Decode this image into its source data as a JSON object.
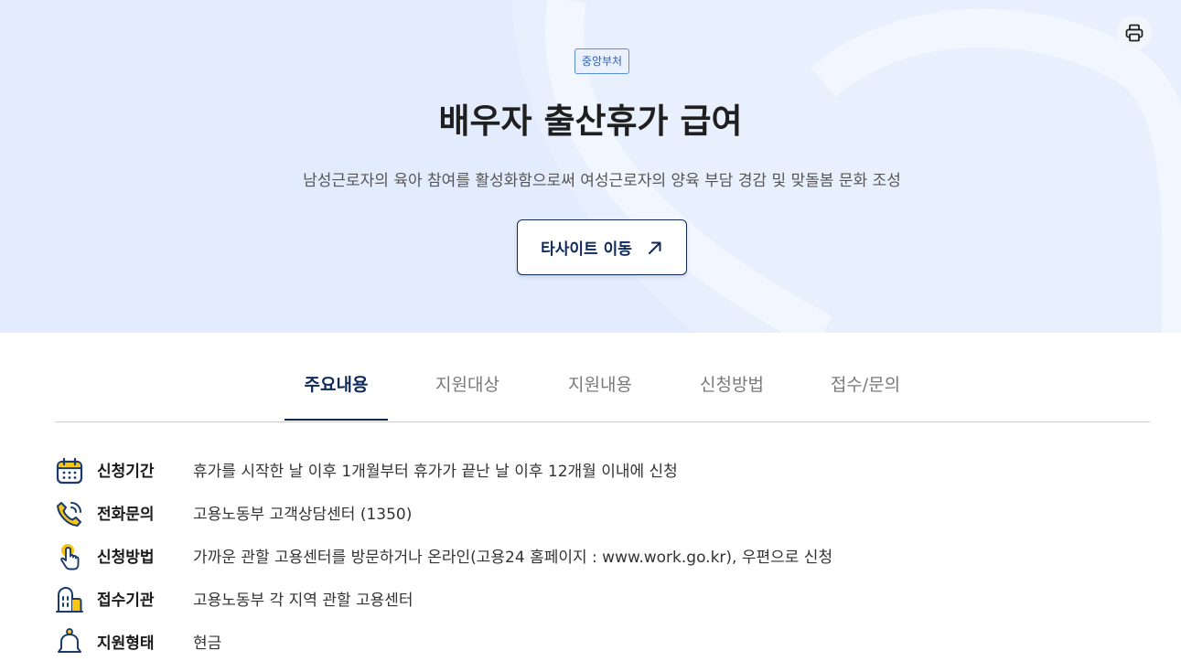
{
  "hero": {
    "badge": "중앙부처",
    "title": "배우자 출산휴가 급여",
    "subtitle": "남성근로자의 육아 참여를 활성화함으로써 여성근로자의 양육 부담 경감 및 맞돌봄 문화 조성",
    "site_button_label": "타사이트 이동"
  },
  "tabs": [
    {
      "label": "주요내용",
      "active": true
    },
    {
      "label": "지원대상",
      "active": false
    },
    {
      "label": "지원내용",
      "active": false
    },
    {
      "label": "신청방법",
      "active": false
    },
    {
      "label": "접수/문의",
      "active": false
    }
  ],
  "info": [
    {
      "icon": "calendar-icon",
      "label": "신청기간",
      "value": "휴가를 시작한 날 이후 1개월부터 휴가가 끝난 날 이후 12개월 이내에 신청"
    },
    {
      "icon": "phone-icon",
      "label": "전화문의",
      "value": "고용노동부 고객상담센터 (1350)"
    },
    {
      "icon": "hand-pointer-icon",
      "label": "신청방법",
      "value": "가까운 관할 고용센터를 방문하거나 온라인(고용24 홈페이지 : www.work.go.kr), 우편으로 신청"
    },
    {
      "icon": "building-icon",
      "label": "접수기관",
      "value": "고용노동부 각 지역 관할 고용센터"
    },
    {
      "icon": "bell-icon",
      "label": "지원형태",
      "value": "현금"
    }
  ],
  "colors": {
    "hero_bg": "#e3ecfd",
    "primary": "#0f2a5a",
    "icon_yellow": "#f5c518",
    "icon_navy": "#1b3a6b"
  }
}
